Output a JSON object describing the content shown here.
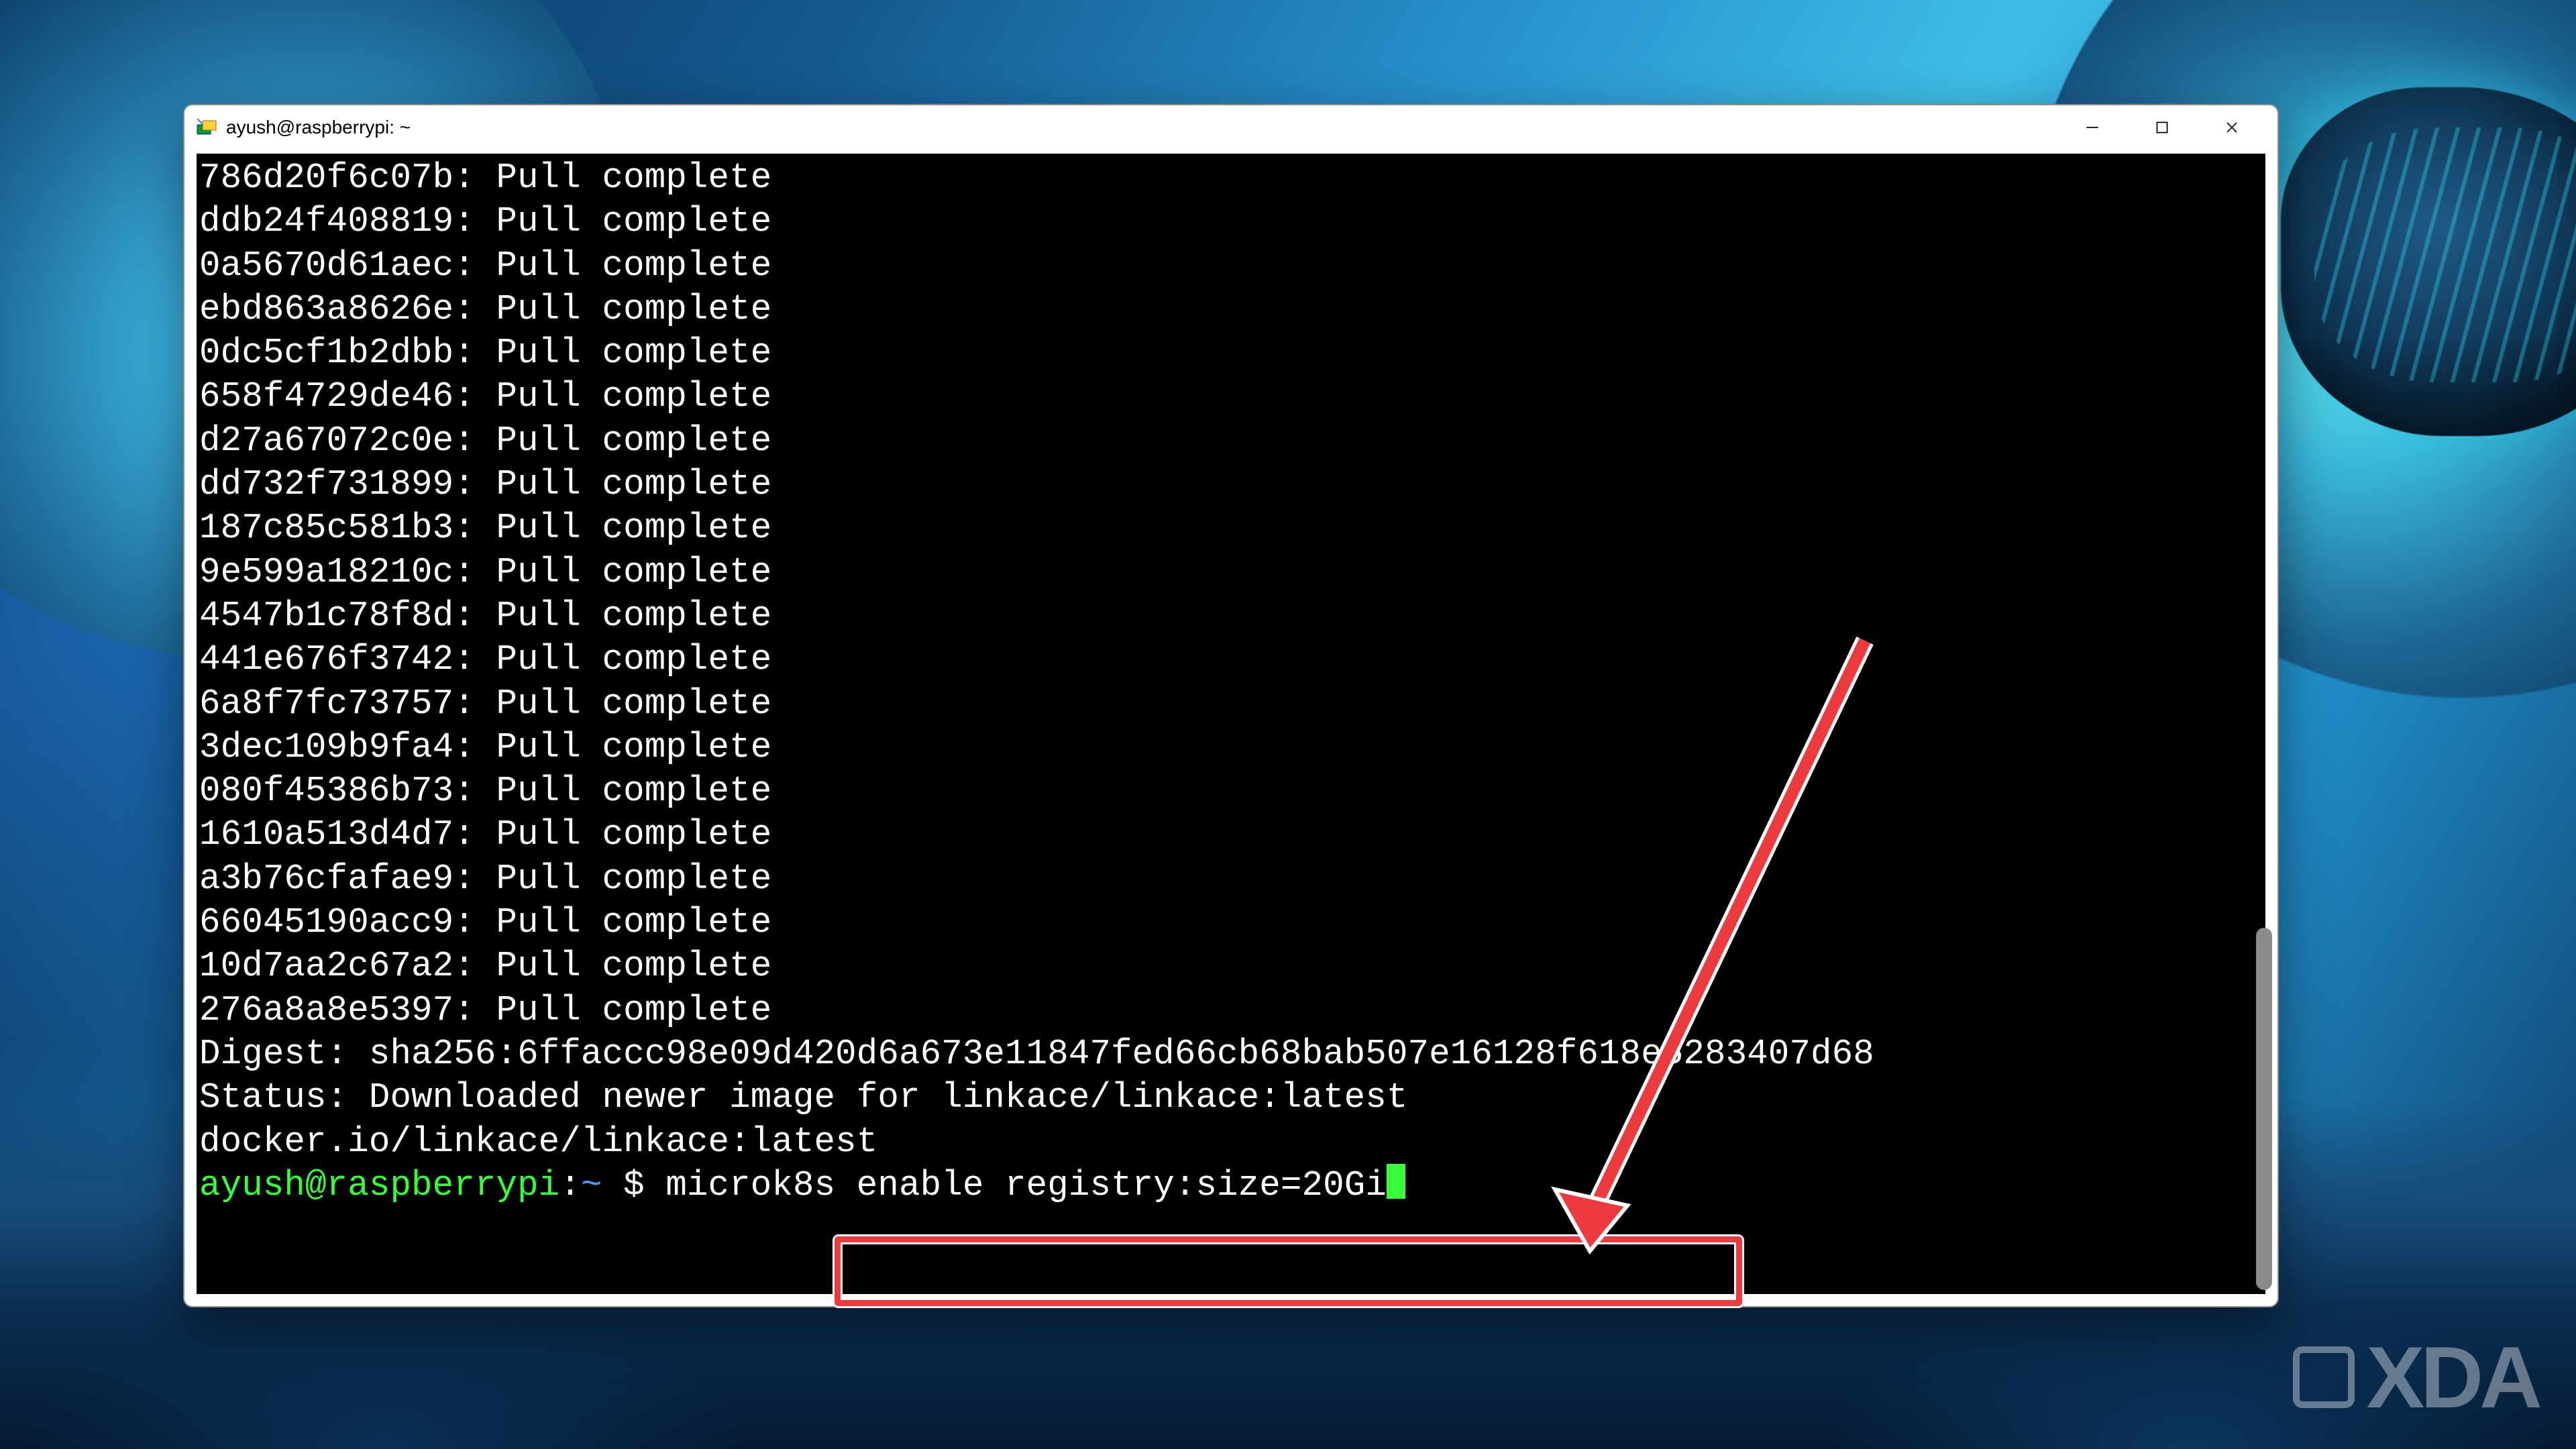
{
  "window": {
    "title": "ayush@raspberrypi: ~",
    "app_icon_name": "putty-icon"
  },
  "terminal": {
    "pull_lines": [
      "786d20f6c07b: Pull complete",
      "ddb24f408819: Pull complete",
      "0a5670d61aec: Pull complete",
      "ebd863a8626e: Pull complete",
      "0dc5cf1b2dbb: Pull complete",
      "658f4729de46: Pull complete",
      "d27a67072c0e: Pull complete",
      "dd732f731899: Pull complete",
      "187c85c581b3: Pull complete",
      "9e599a18210c: Pull complete",
      "4547b1c78f8d: Pull complete",
      "441e676f3742: Pull complete",
      "6a8f7fc73757: Pull complete",
      "3dec109b9fa4: Pull complete",
      "080f45386b73: Pull complete",
      "1610a513d4d7: Pull complete",
      "a3b76cfafae9: Pull complete",
      "66045190acc9: Pull complete",
      "10d7aa2c67a2: Pull complete",
      "276a8a8e5397: Pull complete"
    ],
    "digest_line": "Digest: sha256:6ffaccc98e09d420d6a673e11847fed66cb68bab507e16128f618e5283407d68",
    "status_line": "Status: Downloaded newer image for linkace/linkace:latest",
    "image_line": "docker.io/linkace/linkace:latest",
    "prompt": {
      "user_host": "ayush@raspberrypi",
      "sep": ":",
      "path": "~",
      "symbol": " $ "
    },
    "command": "microk8s enable registry:size=20Gi"
  },
  "watermark": {
    "text": "XDA"
  }
}
